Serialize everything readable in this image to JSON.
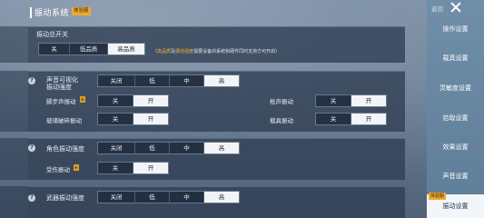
{
  "header": {
    "title": "振动系统",
    "badge": "体验服"
  },
  "master": {
    "label": "振动总开关",
    "options": [
      "关",
      "低品质",
      "高品质"
    ],
    "selected": 2,
    "note_parts": [
      "（",
      "高品质",
      "及",
      "振动强度",
      "需要设备的系统和硬件同时支持方可开启）"
    ]
  },
  "sound": {
    "label_line1": "声音可视化",
    "label_line2": "振动强度",
    "options": [
      "关闭",
      "低",
      "中",
      "高"
    ],
    "selected": 3
  },
  "footstep": {
    "label": "脚步声振动",
    "options": [
      "关",
      "开"
    ],
    "selected": 1
  },
  "gunfire": {
    "label": "枪声振动",
    "options": [
      "关",
      "开"
    ],
    "selected": 1
  },
  "glass": {
    "label": "玻璃破碎振动",
    "options": [
      "关",
      "开"
    ],
    "selected": 1
  },
  "vehicle": {
    "label": "载具振动",
    "options": [
      "关",
      "开"
    ],
    "selected": 1
  },
  "character": {
    "label": "角色振动强度",
    "options": [
      "关闭",
      "低",
      "中",
      "高"
    ],
    "selected": 3
  },
  "hurt": {
    "label": "受伤振动",
    "options": [
      "关",
      "开"
    ],
    "selected": 1
  },
  "weapon": {
    "label": "武器振动强度",
    "options": [
      "关闭",
      "低",
      "中",
      "高"
    ],
    "selected": 3
  },
  "sidebar": {
    "return_label": "返回",
    "items": [
      "操作设置",
      "载具设置",
      "灵敏度设置",
      "拾取设置",
      "效果设置",
      "声音设置",
      "振动设置"
    ],
    "active_index": 6,
    "active_badge": "体验服"
  },
  "icons": {
    "help": "?",
    "new_badge": "新"
  }
}
